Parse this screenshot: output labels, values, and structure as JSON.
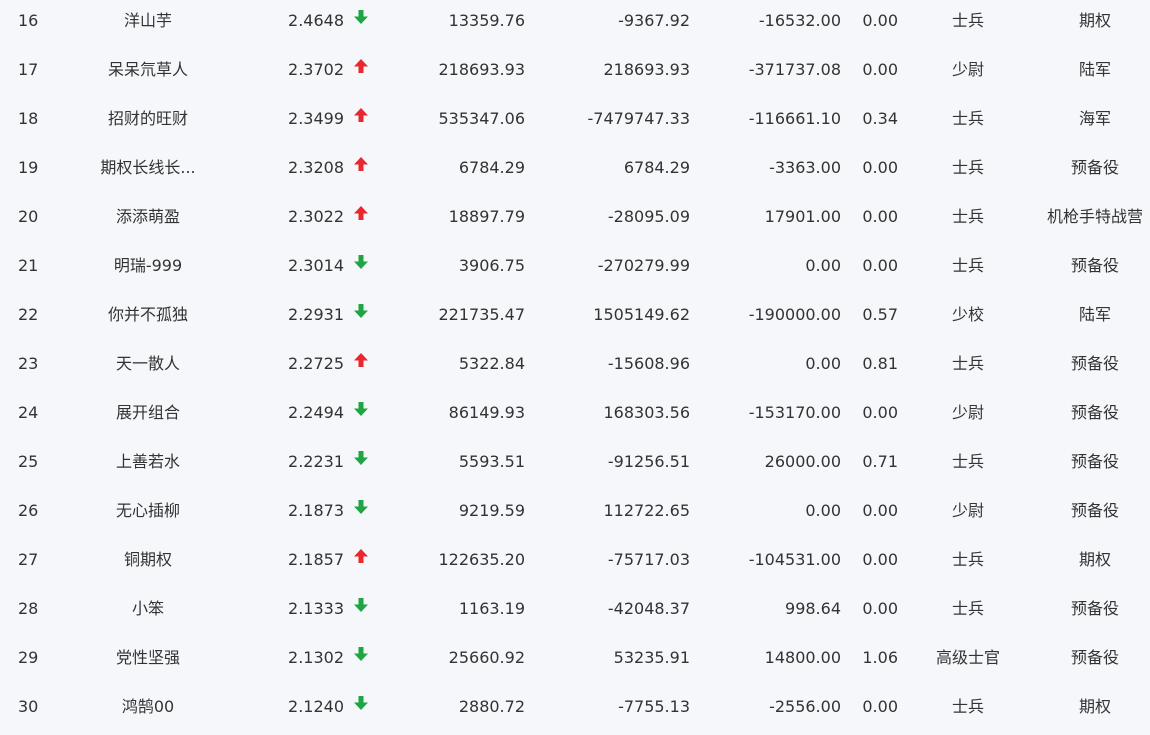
{
  "colors": {
    "background": "#f5f7fa",
    "text": "#333333",
    "up": "#e8272f",
    "down": "#1fa543"
  },
  "rows": [
    {
      "rank": "16",
      "name": "洋山芋",
      "score": "2.4648",
      "trend": "down",
      "v1": "13359.76",
      "v2": "-9367.92",
      "v3": "-16532.00",
      "ratio": "0.00",
      "level": "士兵",
      "type": "期权"
    },
    {
      "rank": "17",
      "name": "呆呆氘草人",
      "score": "2.3702",
      "trend": "up",
      "v1": "218693.93",
      "v2": "218693.93",
      "v3": "-371737.08",
      "ratio": "0.00",
      "level": "少尉",
      "type": "陆军"
    },
    {
      "rank": "18",
      "name": "招财的旺财",
      "score": "2.3499",
      "trend": "up",
      "v1": "535347.06",
      "v2": "-7479747.33",
      "v3": "-116661.10",
      "ratio": "0.34",
      "level": "士兵",
      "type": "海军"
    },
    {
      "rank": "19",
      "name": "期权长线长...",
      "score": "2.3208",
      "trend": "up",
      "v1": "6784.29",
      "v2": "6784.29",
      "v3": "-3363.00",
      "ratio": "0.00",
      "level": "士兵",
      "type": "预备役"
    },
    {
      "rank": "20",
      "name": "添添萌盈",
      "score": "2.3022",
      "trend": "up",
      "v1": "18897.79",
      "v2": "-28095.09",
      "v3": "17901.00",
      "ratio": "0.00",
      "level": "士兵",
      "type": "机枪手特战营"
    },
    {
      "rank": "21",
      "name": "明瑞-999",
      "score": "2.3014",
      "trend": "down",
      "v1": "3906.75",
      "v2": "-270279.99",
      "v3": "0.00",
      "ratio": "0.00",
      "level": "士兵",
      "type": "预备役"
    },
    {
      "rank": "22",
      "name": "你并不孤独",
      "score": "2.2931",
      "trend": "down",
      "v1": "221735.47",
      "v2": "1505149.62",
      "v3": "-190000.00",
      "ratio": "0.57",
      "level": "少校",
      "type": "陆军"
    },
    {
      "rank": "23",
      "name": "天一散人",
      "score": "2.2725",
      "trend": "up",
      "v1": "5322.84",
      "v2": "-15608.96",
      "v3": "0.00",
      "ratio": "0.81",
      "level": "士兵",
      "type": "预备役"
    },
    {
      "rank": "24",
      "name": "展开组合",
      "score": "2.2494",
      "trend": "down",
      "v1": "86149.93",
      "v2": "168303.56",
      "v3": "-153170.00",
      "ratio": "0.00",
      "level": "少尉",
      "type": "预备役"
    },
    {
      "rank": "25",
      "name": "上善若水",
      "score": "2.2231",
      "trend": "down",
      "v1": "5593.51",
      "v2": "-91256.51",
      "v3": "26000.00",
      "ratio": "0.71",
      "level": "士兵",
      "type": "预备役"
    },
    {
      "rank": "26",
      "name": "无心插柳",
      "score": "2.1873",
      "trend": "down",
      "v1": "9219.59",
      "v2": "112722.65",
      "v3": "0.00",
      "ratio": "0.00",
      "level": "少尉",
      "type": "预备役"
    },
    {
      "rank": "27",
      "name": "铜期权",
      "score": "2.1857",
      "trend": "up",
      "v1": "122635.20",
      "v2": "-75717.03",
      "v3": "-104531.00",
      "ratio": "0.00",
      "level": "士兵",
      "type": "期权"
    },
    {
      "rank": "28",
      "name": "小笨",
      "score": "2.1333",
      "trend": "down",
      "v1": "1163.19",
      "v2": "-42048.37",
      "v3": "998.64",
      "ratio": "0.00",
      "level": "士兵",
      "type": "预备役"
    },
    {
      "rank": "29",
      "name": "党性坚强",
      "score": "2.1302",
      "trend": "down",
      "v1": "25660.92",
      "v2": "53235.91",
      "v3": "14800.00",
      "ratio": "1.06",
      "level": "高级士官",
      "type": "预备役"
    },
    {
      "rank": "30",
      "name": "鸿鹄00",
      "score": "2.1240",
      "trend": "down",
      "v1": "2880.72",
      "v2": "-7755.13",
      "v3": "-2556.00",
      "ratio": "0.00",
      "level": "士兵",
      "type": "期权"
    }
  ]
}
